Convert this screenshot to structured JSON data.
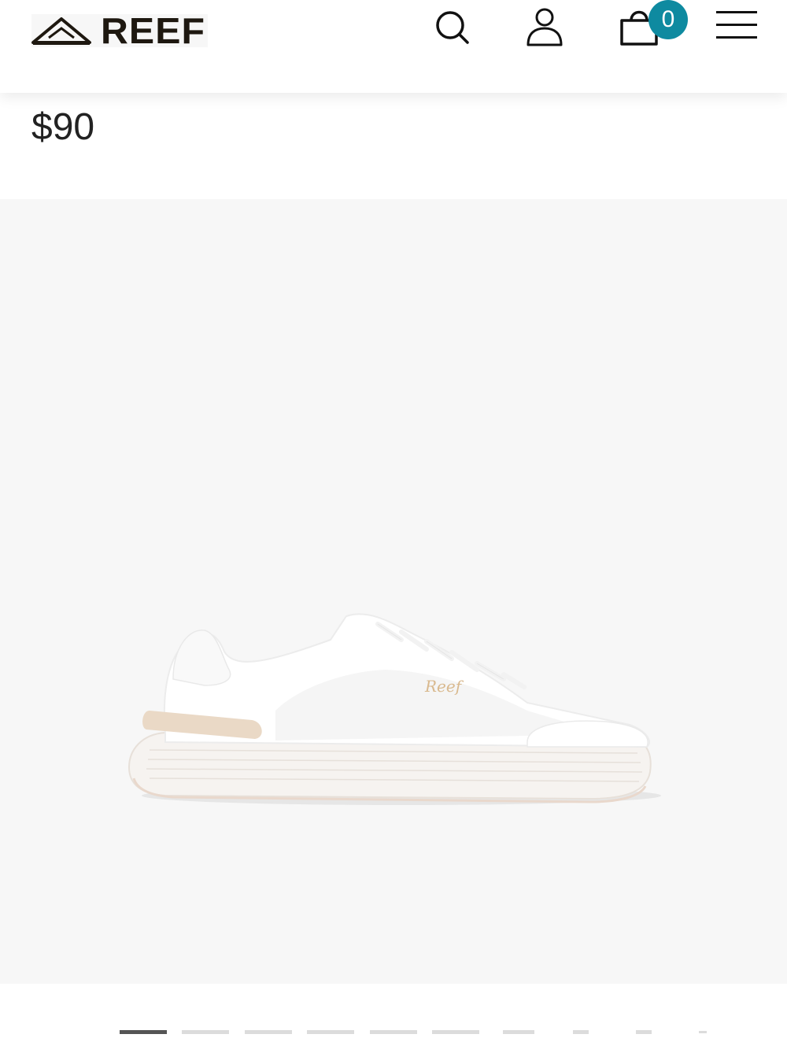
{
  "header": {
    "brand": "REEF",
    "icons": {
      "search": "search-icon",
      "account": "account-icon",
      "cart": "shopping-bag-icon",
      "menu": "hamburger-menu-icon"
    },
    "cart_count": "0",
    "accent_color": "#0e8aa0"
  },
  "product": {
    "price": "$90"
  },
  "gallery": {
    "shoe_logo_text": "Reef",
    "slide_count": 10,
    "active_slide": 1
  }
}
